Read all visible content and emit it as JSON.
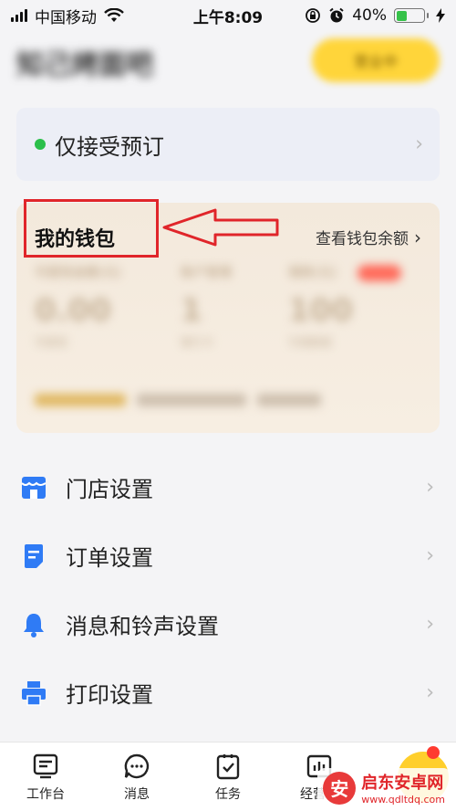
{
  "status_bar": {
    "carrier": "中国移动",
    "time": "上午8:09",
    "battery": "40%",
    "battery_level": 0.4
  },
  "header": {
    "store_name": "知己烤面吧",
    "action_label": "营业中"
  },
  "order_status": {
    "text": "仅接受预订",
    "dot_color": "#2bbf4a"
  },
  "wallet": {
    "title": "我的钱包",
    "link": "查看钱包余额",
    "stats": [
      {
        "label": "可提现金额(元)",
        "value": "0.00",
        "sub": "可提现"
      },
      {
        "label": "账户管理",
        "value": "1",
        "sub": "银行卡"
      },
      {
        "label": "借款(元)",
        "value": "100",
        "sub": "可借额度"
      }
    ]
  },
  "settings": [
    {
      "icon": "store-icon",
      "label": "门店设置"
    },
    {
      "icon": "order-icon",
      "label": "订单设置"
    },
    {
      "icon": "bell-icon",
      "label": "消息和铃声设置"
    },
    {
      "icon": "printer-icon",
      "label": "打印设置"
    }
  ],
  "tabs": [
    {
      "icon": "workbench-icon",
      "label": "工作台"
    },
    {
      "icon": "message-icon",
      "label": "消息"
    },
    {
      "icon": "task-icon",
      "label": "任务"
    },
    {
      "icon": "chart-icon",
      "label": "经营指"
    }
  ],
  "watermark": {
    "title": "启东安卓网",
    "url": "www.qdltdq.com"
  },
  "colors": {
    "accent": "#ffd53a",
    "highlight": "#e0252a",
    "icon_blue": "#2f7bf5"
  }
}
